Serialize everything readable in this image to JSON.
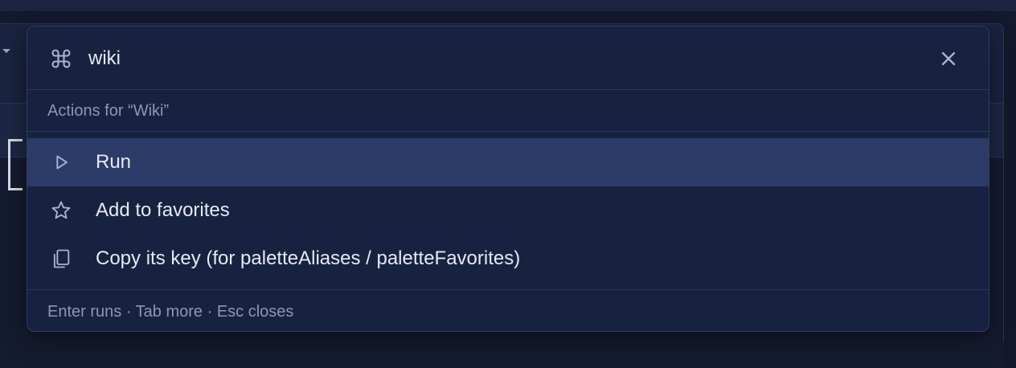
{
  "palette": {
    "query": "wiki",
    "icons": {
      "search": "command-icon",
      "close": "close-icon"
    },
    "header": "Actions for “Wiki”",
    "items": [
      {
        "label": "Run",
        "icon": "play-icon",
        "selected": true
      },
      {
        "label": "Add to favorites",
        "icon": "star-icon",
        "selected": false
      },
      {
        "label": "Copy its key (for paletteAliases / paletteFavorites)",
        "icon": "copy-icon",
        "selected": false
      }
    ],
    "footer": "Enter runs · Tab more · Esc closes"
  },
  "colors": {
    "surface": "#172241",
    "selected_row": "#2c3b67",
    "text": "#e6e9f2",
    "muted_text": "#8c97b6"
  }
}
